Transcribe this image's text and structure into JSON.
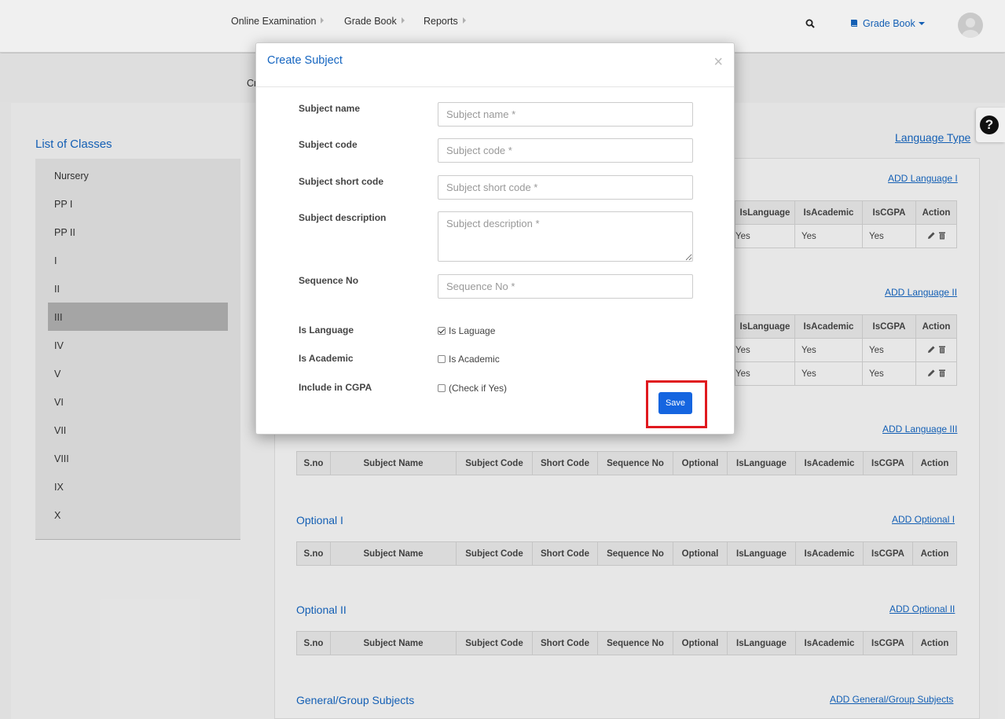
{
  "nav": {
    "items": [
      "Online Examination",
      "Grade Book",
      "Reports"
    ],
    "gradebook_menu_label": "Grade Book"
  },
  "subheader": {
    "tab_fragment": "Cr"
  },
  "classes": {
    "title": "List of Classes",
    "items": [
      "Nursery",
      "PP I",
      "PP II",
      "I",
      "II",
      "III",
      "IV",
      "V",
      "VI",
      "VII",
      "VIII",
      "IX",
      "X"
    ],
    "active": "III"
  },
  "language_type_link": "Language Type",
  "sections": {
    "lang1": {
      "add_label": "ADD Language I",
      "headers": [
        "IsLanguage",
        "IsAcademic",
        "IsCGPA",
        "Action"
      ],
      "rows": [
        [
          "Yes",
          "Yes",
          "Yes"
        ]
      ]
    },
    "lang2": {
      "add_label": "ADD Language II",
      "headers": [
        "IsLanguage",
        "IsAcademic",
        "IsCGPA",
        "Action"
      ],
      "rows": [
        [
          "Yes",
          "Yes",
          "Yes"
        ],
        [
          "Yes",
          "Yes",
          "Yes"
        ]
      ]
    },
    "lang3": {
      "add_label": "ADD Language III"
    },
    "optional1": {
      "title": "Optional I",
      "add_label": "ADD Optional I"
    },
    "optional2": {
      "title": "Optional II",
      "add_label": "ADD Optional II"
    },
    "general": {
      "title": "General/Group Subjects",
      "add_label": "ADD General/Group Subjects"
    }
  },
  "table_headers": [
    "S.no",
    "Subject Name",
    "Subject Code",
    "Short Code",
    "Sequence No",
    "Optional",
    "IsLanguage",
    "IsAcademic",
    "IsCGPA",
    "Action"
  ],
  "modal": {
    "title": "Create Subject",
    "close": "×",
    "fields": {
      "subject_name": {
        "label": "Subject name",
        "placeholder": "Subject name *"
      },
      "subject_code": {
        "label": "Subject code",
        "placeholder": "Subject code *"
      },
      "short_code": {
        "label": "Subject short code",
        "placeholder": "Subject short code *"
      },
      "description": {
        "label": "Subject description",
        "placeholder": "Subject description *"
      },
      "sequence": {
        "label": "Sequence No",
        "placeholder": "Sequence No *"
      }
    },
    "checks": {
      "is_language": {
        "label": "Is Language",
        "text": "Is Laguage",
        "checked": true
      },
      "is_academic": {
        "label": "Is Academic",
        "text": "Is Academic",
        "checked": false
      },
      "cgpa": {
        "label": "Include in CGPA",
        "text": "(Check if Yes)",
        "checked": false
      }
    },
    "save_label": "Save"
  },
  "colors": {
    "accent": "#1565c0",
    "button": "#1565e0",
    "highlight": "#e0191f"
  },
  "icons": [
    "search-icon",
    "book-icon",
    "avatar",
    "help-icon",
    "edit-icon",
    "trash-icon",
    "close-icon"
  ]
}
